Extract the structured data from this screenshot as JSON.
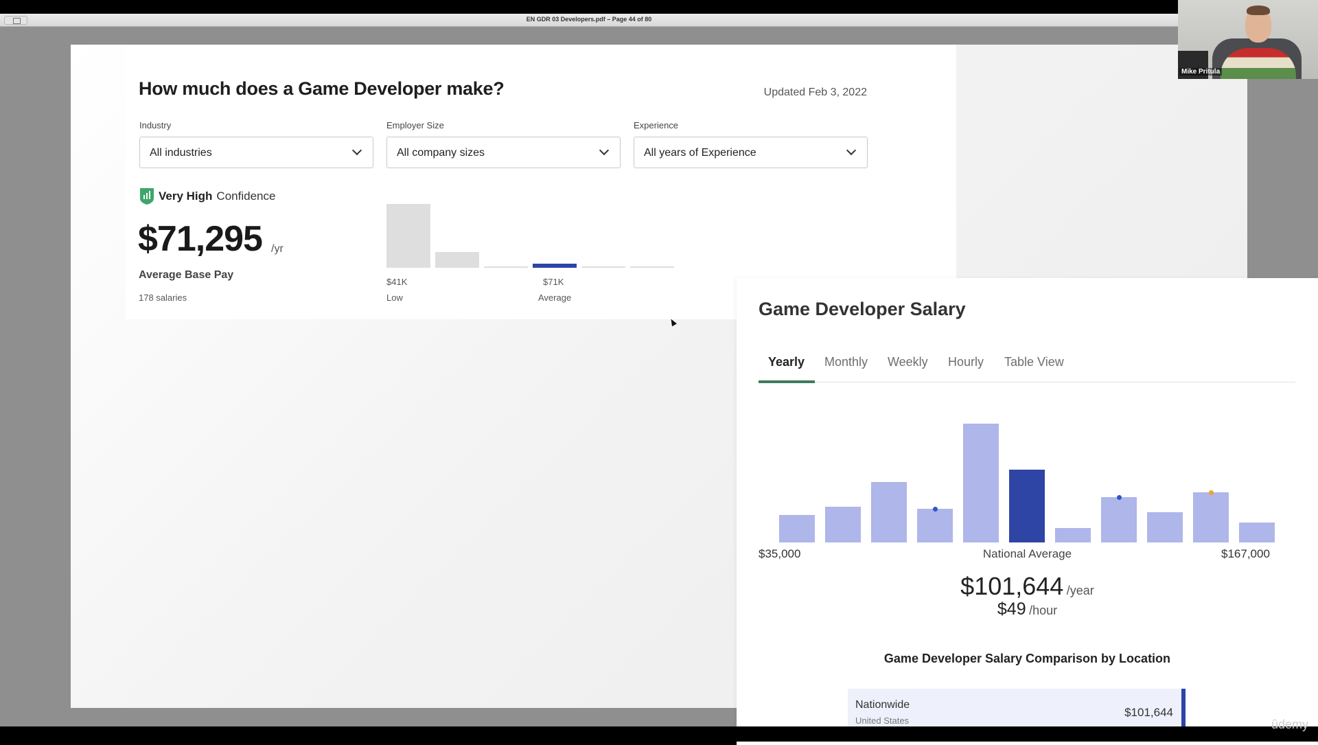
{
  "window": {
    "doc_title": "EN GDR 03 Developers.pdf – Page 44 of 80"
  },
  "page": {
    "heading": "How much does a Game Developer make?",
    "updated": "Updated Feb 3, 2022",
    "filters": [
      {
        "label": "Industry",
        "value": "All industries"
      },
      {
        "label": "Employer Size",
        "value": "All company sizes"
      },
      {
        "label": "Experience",
        "value": "All years of Experience"
      }
    ],
    "confidence_strong": "Very High",
    "confidence_rest": "Confidence",
    "average_pay": "$71,295",
    "average_pay_unit": "/yr",
    "average_pay_label": "Average Base Pay",
    "salaries_count": "178 salaries",
    "histogram_labels": {
      "low_value": "$41K",
      "low_label": "Low",
      "avg_value": "$71K",
      "avg_label": "Average"
    }
  },
  "panel": {
    "title": "Game Developer Salary",
    "tabs": [
      "Yearly",
      "Monthly",
      "Weekly",
      "Hourly",
      "Table View"
    ],
    "axis_min": "$35,000",
    "axis_mid": "National Average",
    "axis_max": "$167,000",
    "yearly_value": "$101,644",
    "yearly_unit": "/year",
    "hourly_value": "$49",
    "hourly_unit": "/hour",
    "comparison_title": "Game Developer Salary Comparison by Location",
    "location": {
      "name": "Nationwide",
      "country": "United States",
      "value": "$101,644"
    }
  },
  "colors": {
    "bar_light": "#aeb6ea",
    "bar_dark": "#2e45a6",
    "tab_accent": "#3f7a5e",
    "dot_blue": "#2e56c8",
    "dot_orange": "#f0a030"
  },
  "chart_data": [
    {
      "type": "bar",
      "values": [
        30,
        7.5,
        0.5,
        2,
        0.5,
        0.5
      ],
      "highlight_index": 3,
      "ylim": [
        0,
        30
      ]
    },
    {
      "type": "bar",
      "values": [
        40,
        52,
        88,
        49,
        173,
        106,
        21,
        66,
        44,
        73,
        29
      ],
      "highlight_index": 5,
      "dots": [
        {
          "index": 3,
          "value": 49,
          "color": "blue"
        },
        {
          "index": 7,
          "value": 66,
          "color": "blue"
        },
        {
          "index": 9,
          "value": 73,
          "color": "orange"
        }
      ],
      "ylim": [
        0,
        173
      ]
    }
  ]
}
